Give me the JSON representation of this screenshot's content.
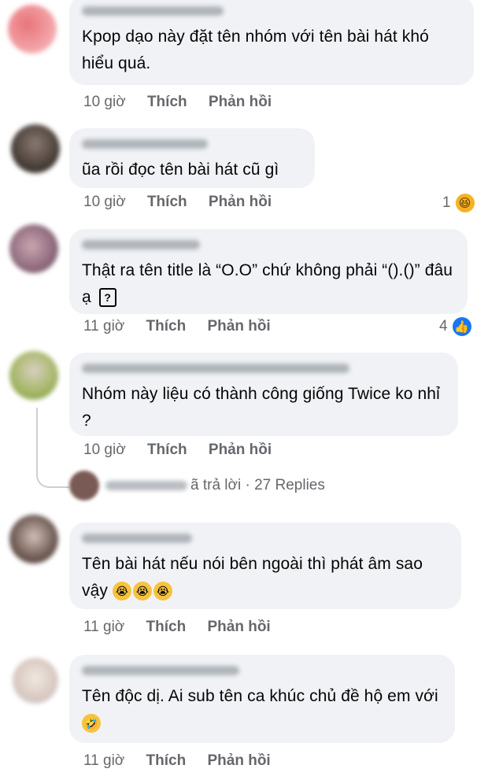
{
  "comments": [
    {
      "text": "Kpop dạo này đặt tên nhóm với tên bài hát khó hiểu quá.",
      "time": "10 giờ",
      "like": "Thích",
      "reply": "Phản hồi"
    },
    {
      "text": "ũa rồi đọc tên bài hát cũ gì",
      "time": "10 giờ",
      "like": "Thích",
      "reply": "Phản hồi",
      "reaction_count": "1",
      "reaction_icon": "haha-icon"
    },
    {
      "text": "Thật ra tên title là “O.O” chứ không phải “().()” đâu ạ",
      "time": "11 giờ",
      "like": "Thích",
      "reply": "Phản hồi",
      "reaction_count": "4",
      "reaction_icon": "like-icon"
    },
    {
      "text": "Nhóm này liệu có thành công giống Twice ko nhỉ ?",
      "time": "10 giờ",
      "like": "Thích",
      "reply": "Phản hồi",
      "replies_text": "ã trả lời · 27 Replies"
    },
    {
      "text": "Tên bài hát nếu nói bên ngoài thì phát âm sao vậy",
      "time": "11 giờ",
      "like": "Thích",
      "reply": "Phản hồi"
    },
    {
      "text": "Tên độc dị. Ai sub tên ca khúc chủ đề hộ em với",
      "time": "11 giờ",
      "like": "Thích",
      "reply": "Phản hồi"
    }
  ],
  "glyphs": {
    "question_box": "?",
    "cry": "😭",
    "rofl": "🤣",
    "haha": "😆",
    "like": "👍"
  },
  "colors": {
    "bubble": "#f0f2f5",
    "meta": "#65676b",
    "like_blue": "#1877f2",
    "haha_yellow": "#f7b125"
  }
}
